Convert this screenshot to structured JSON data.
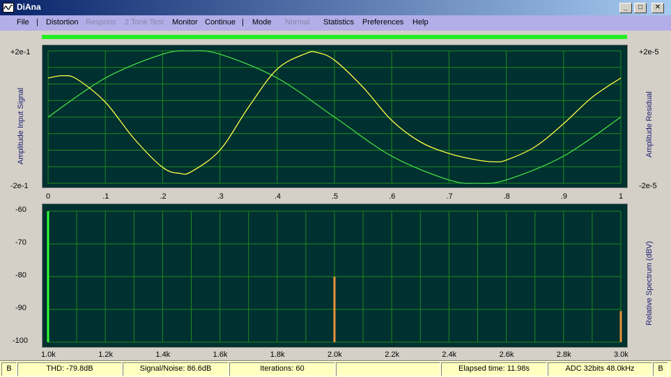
{
  "window": {
    "title": "DiAna",
    "minimize": "_",
    "maximize": "□",
    "close": "✕"
  },
  "menu": [
    {
      "label": "File",
      "enabled": true
    },
    {
      "label": "Distortion",
      "enabled": true
    },
    {
      "label": "Respons",
      "enabled": false
    },
    {
      "label": "2 Tone Test",
      "enabled": false
    },
    {
      "label": "Monitor",
      "enabled": true
    },
    {
      "label": "Continue",
      "enabled": true
    },
    {
      "label": "Mode",
      "enabled": true
    },
    {
      "label": "Normal",
      "enabled": false
    },
    {
      "label": "Statistics",
      "enabled": true
    },
    {
      "label": "Preferences",
      "enabled": true
    },
    {
      "label": "Help",
      "enabled": true
    }
  ],
  "menu_separator": "|",
  "level_meter": {
    "fraction": 1.0,
    "color": "#22ee22"
  },
  "colors": {
    "plot_bg": "#003030",
    "grid": "#1f8a1f",
    "input_trace": "#ffff44",
    "residual_trace": "#44dd44",
    "fundamental": "#33ff33",
    "harmonic": "#e8923a"
  },
  "chart_data": [
    {
      "type": "line",
      "ylabel_left": "Amplitude Input Signal",
      "ylabel_right": "Amplitude Residual",
      "y_left_ticks": [
        "+2e-1",
        "-2e-1"
      ],
      "y_right_ticks": [
        "+2e-5",
        "-2e-5"
      ],
      "x_ticks": [
        "0",
        ".1",
        ".2",
        ".3",
        ".4",
        ".5",
        ".6",
        ".7",
        ".8",
        ".9",
        "1"
      ],
      "xlim": [
        0,
        1
      ],
      "grid": true,
      "series": [
        {
          "color": "#44dd44",
          "x": [
            0,
            0.1,
            0.2,
            0.25,
            0.3,
            0.4,
            0.5,
            0.6,
            0.7,
            0.75,
            0.8,
            0.9,
            1.0
          ],
          "y": [
            0,
            0.118,
            0.19,
            0.2,
            0.19,
            0.118,
            0,
            -0.118,
            -0.19,
            -0.2,
            -0.19,
            -0.118,
            0
          ]
        },
        {
          "color": "#ffff44",
          "x": [
            0,
            0.025,
            0.05,
            0.1,
            0.15,
            0.2,
            0.23,
            0.25,
            0.3,
            0.35,
            0.4,
            0.45,
            0.47,
            0.5,
            0.55,
            0.6,
            0.65,
            0.7,
            0.75,
            0.78,
            0.8,
            0.85,
            0.9,
            0.95,
            1.0
          ],
          "y": [
            0.118,
            0.125,
            0.115,
            0.045,
            -0.065,
            -0.152,
            -0.17,
            -0.165,
            -0.1,
            0.03,
            0.145,
            0.192,
            0.195,
            0.172,
            0.09,
            -0.01,
            -0.075,
            -0.11,
            -0.13,
            -0.135,
            -0.13,
            -0.09,
            -0.02,
            0.06,
            0.118
          ]
        }
      ]
    },
    {
      "type": "bar",
      "ylabel_right": "Relative Spectrum (dBV)",
      "y_ticks": [
        "-60",
        "-70",
        "-80",
        "-90",
        "-100"
      ],
      "ylim": [
        -100,
        -60
      ],
      "x_ticks": [
        "1.0k",
        "1.2k",
        "1.4k",
        "1.6k",
        "1.8k",
        "2.0k",
        "2.2k",
        "2.4k",
        "2.6k",
        "2.8k",
        "3.0k"
      ],
      "xlim": [
        1000,
        3000
      ],
      "grid": true,
      "bars": [
        {
          "x": 1000,
          "value": -60,
          "color": "#33ff33"
        },
        {
          "x": 2000,
          "value": -80,
          "color": "#e8923a"
        },
        {
          "x": 3000,
          "value": -90.5,
          "color": "#e8923a"
        }
      ]
    }
  ],
  "status": {
    "left_flag": "B",
    "thd": "THD:  -79.8dB",
    "sn": "Signal/Noise:   86.6dB",
    "iterations": "Iterations: 60",
    "blank": "",
    "elapsed": "Elapsed time: 11.98s",
    "adc": "ADC 32bits 48.0kHz",
    "right_flag": "B"
  }
}
